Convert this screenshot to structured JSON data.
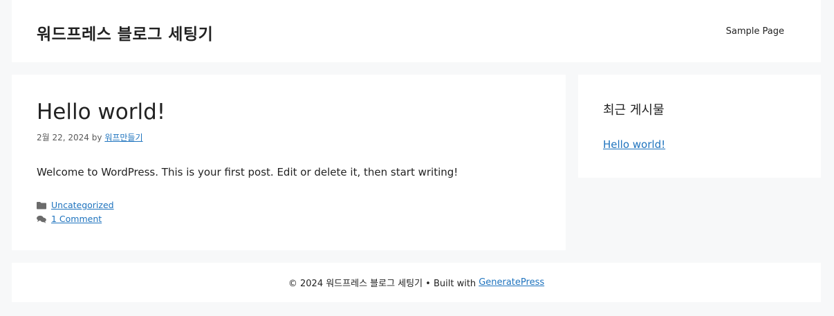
{
  "header": {
    "site_title": "워드프레스 블로그 세팅기",
    "nav": [
      {
        "label": "Sample Page"
      }
    ]
  },
  "post": {
    "title": "Hello world!",
    "date": "2월 22, 2024",
    "by_label": "by",
    "author": "워프만들기",
    "body": "Welcome to WordPress. This is your first post. Edit or delete it, then start writing!",
    "category": "Uncategorized",
    "comments": "1 Comment",
    "icons": {
      "category": "folder-icon",
      "comments": "comments-icon"
    }
  },
  "sidebar": {
    "widget_title": "최근 게시물",
    "recent_posts": [
      {
        "title": "Hello world!"
      }
    ]
  },
  "footer": {
    "copyright": "© 2024 워드프레스 블로그 세팅기 • Built with",
    "theme_link": "GeneratePress"
  },
  "colors": {
    "background": "#f7f8f9",
    "surface": "#ffffff",
    "link": "#1e73be",
    "text": "#222222"
  }
}
